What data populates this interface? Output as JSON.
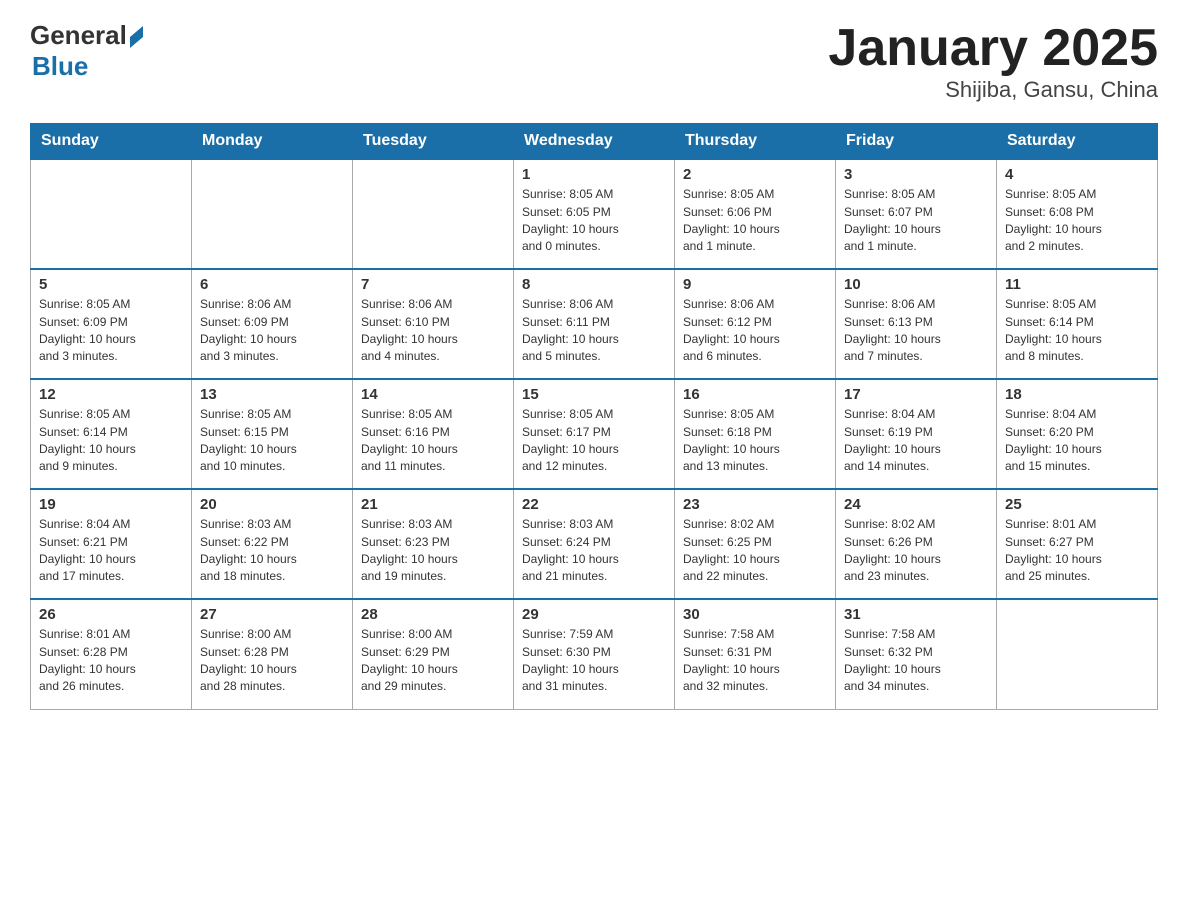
{
  "header": {
    "logo_general": "General",
    "logo_blue": "Blue",
    "month": "January 2025",
    "location": "Shijiba, Gansu, China"
  },
  "weekdays": [
    "Sunday",
    "Monday",
    "Tuesday",
    "Wednesday",
    "Thursday",
    "Friday",
    "Saturday"
  ],
  "weeks": [
    [
      {
        "day": "",
        "info": ""
      },
      {
        "day": "",
        "info": ""
      },
      {
        "day": "",
        "info": ""
      },
      {
        "day": "1",
        "info": "Sunrise: 8:05 AM\nSunset: 6:05 PM\nDaylight: 10 hours\nand 0 minutes."
      },
      {
        "day": "2",
        "info": "Sunrise: 8:05 AM\nSunset: 6:06 PM\nDaylight: 10 hours\nand 1 minute."
      },
      {
        "day": "3",
        "info": "Sunrise: 8:05 AM\nSunset: 6:07 PM\nDaylight: 10 hours\nand 1 minute."
      },
      {
        "day": "4",
        "info": "Sunrise: 8:05 AM\nSunset: 6:08 PM\nDaylight: 10 hours\nand 2 minutes."
      }
    ],
    [
      {
        "day": "5",
        "info": "Sunrise: 8:05 AM\nSunset: 6:09 PM\nDaylight: 10 hours\nand 3 minutes."
      },
      {
        "day": "6",
        "info": "Sunrise: 8:06 AM\nSunset: 6:09 PM\nDaylight: 10 hours\nand 3 minutes."
      },
      {
        "day": "7",
        "info": "Sunrise: 8:06 AM\nSunset: 6:10 PM\nDaylight: 10 hours\nand 4 minutes."
      },
      {
        "day": "8",
        "info": "Sunrise: 8:06 AM\nSunset: 6:11 PM\nDaylight: 10 hours\nand 5 minutes."
      },
      {
        "day": "9",
        "info": "Sunrise: 8:06 AM\nSunset: 6:12 PM\nDaylight: 10 hours\nand 6 minutes."
      },
      {
        "day": "10",
        "info": "Sunrise: 8:06 AM\nSunset: 6:13 PM\nDaylight: 10 hours\nand 7 minutes."
      },
      {
        "day": "11",
        "info": "Sunrise: 8:05 AM\nSunset: 6:14 PM\nDaylight: 10 hours\nand 8 minutes."
      }
    ],
    [
      {
        "day": "12",
        "info": "Sunrise: 8:05 AM\nSunset: 6:14 PM\nDaylight: 10 hours\nand 9 minutes."
      },
      {
        "day": "13",
        "info": "Sunrise: 8:05 AM\nSunset: 6:15 PM\nDaylight: 10 hours\nand 10 minutes."
      },
      {
        "day": "14",
        "info": "Sunrise: 8:05 AM\nSunset: 6:16 PM\nDaylight: 10 hours\nand 11 minutes."
      },
      {
        "day": "15",
        "info": "Sunrise: 8:05 AM\nSunset: 6:17 PM\nDaylight: 10 hours\nand 12 minutes."
      },
      {
        "day": "16",
        "info": "Sunrise: 8:05 AM\nSunset: 6:18 PM\nDaylight: 10 hours\nand 13 minutes."
      },
      {
        "day": "17",
        "info": "Sunrise: 8:04 AM\nSunset: 6:19 PM\nDaylight: 10 hours\nand 14 minutes."
      },
      {
        "day": "18",
        "info": "Sunrise: 8:04 AM\nSunset: 6:20 PM\nDaylight: 10 hours\nand 15 minutes."
      }
    ],
    [
      {
        "day": "19",
        "info": "Sunrise: 8:04 AM\nSunset: 6:21 PM\nDaylight: 10 hours\nand 17 minutes."
      },
      {
        "day": "20",
        "info": "Sunrise: 8:03 AM\nSunset: 6:22 PM\nDaylight: 10 hours\nand 18 minutes."
      },
      {
        "day": "21",
        "info": "Sunrise: 8:03 AM\nSunset: 6:23 PM\nDaylight: 10 hours\nand 19 minutes."
      },
      {
        "day": "22",
        "info": "Sunrise: 8:03 AM\nSunset: 6:24 PM\nDaylight: 10 hours\nand 21 minutes."
      },
      {
        "day": "23",
        "info": "Sunrise: 8:02 AM\nSunset: 6:25 PM\nDaylight: 10 hours\nand 22 minutes."
      },
      {
        "day": "24",
        "info": "Sunrise: 8:02 AM\nSunset: 6:26 PM\nDaylight: 10 hours\nand 23 minutes."
      },
      {
        "day": "25",
        "info": "Sunrise: 8:01 AM\nSunset: 6:27 PM\nDaylight: 10 hours\nand 25 minutes."
      }
    ],
    [
      {
        "day": "26",
        "info": "Sunrise: 8:01 AM\nSunset: 6:28 PM\nDaylight: 10 hours\nand 26 minutes."
      },
      {
        "day": "27",
        "info": "Sunrise: 8:00 AM\nSunset: 6:28 PM\nDaylight: 10 hours\nand 28 minutes."
      },
      {
        "day": "28",
        "info": "Sunrise: 8:00 AM\nSunset: 6:29 PM\nDaylight: 10 hours\nand 29 minutes."
      },
      {
        "day": "29",
        "info": "Sunrise: 7:59 AM\nSunset: 6:30 PM\nDaylight: 10 hours\nand 31 minutes."
      },
      {
        "day": "30",
        "info": "Sunrise: 7:58 AM\nSunset: 6:31 PM\nDaylight: 10 hours\nand 32 minutes."
      },
      {
        "day": "31",
        "info": "Sunrise: 7:58 AM\nSunset: 6:32 PM\nDaylight: 10 hours\nand 34 minutes."
      },
      {
        "day": "",
        "info": ""
      }
    ]
  ]
}
